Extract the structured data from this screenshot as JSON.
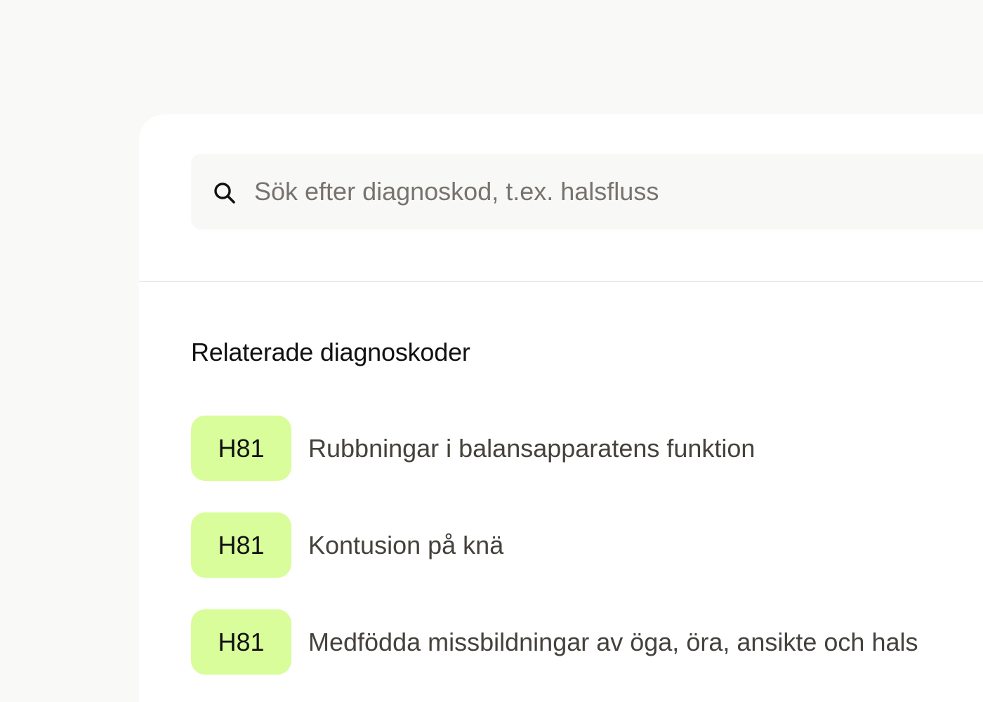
{
  "search": {
    "placeholder": "Sök efter diagnoskod, t.ex. halsfluss",
    "value": ""
  },
  "related": {
    "title": "Relaterade diagnoskoder",
    "items": [
      {
        "code": "H81",
        "description": "Rubbningar i balansapparatens funktion"
      },
      {
        "code": "H81",
        "description": "Kontusion på knä"
      },
      {
        "code": "H81",
        "description": "Medfödda missbildningar av öga, öra, ansikte och hals"
      }
    ]
  },
  "colors": {
    "page_background": "#f9f9f8",
    "card_background": "#ffffff",
    "search_background": "#f8f8f7",
    "badge_background": "#d8fd9a",
    "placeholder_text": "#77736d",
    "description_text": "#45413c"
  },
  "icons": {
    "search": "magnifying-glass"
  }
}
